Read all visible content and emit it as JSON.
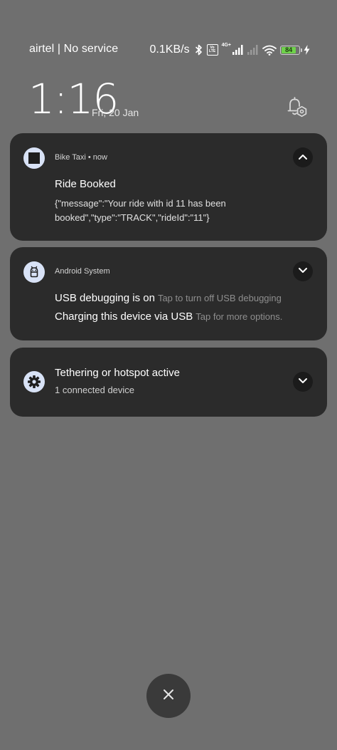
{
  "status_bar": {
    "carrier": "airtel | No service",
    "net_speed": "0.1KB/s",
    "volte_line1": "Vo",
    "volte_line2": "LTE",
    "net_type": "4G+",
    "battery_level": 84,
    "battery_level_text": "84",
    "battery_color": "#6fd24b",
    "icons": [
      "bluetooth-icon",
      "volte-icon",
      "signal-icon",
      "signal-no-service-icon",
      "wifi-icon",
      "battery-icon",
      "charging-icon"
    ]
  },
  "lockscreen": {
    "time": "1:16",
    "date": "Fri, 20 Jan",
    "settings_icon": "notification-settings-icon"
  },
  "notifications": [
    {
      "app": "Bike Taxi",
      "time": "now",
      "header": "Bike Taxi  •  now",
      "title": "Ride Booked",
      "body": "{\"message\":\"Your ride with id 11 has been booked\",\"type\":\"TRACK\",\"rideId\":\"11\"}",
      "icon": "app-square-icon",
      "expand_icon": "chevron-up-icon"
    },
    {
      "app": "Android System",
      "icon": "android-system-icon",
      "expand_icon": "chevron-down-icon",
      "items": [
        {
          "title": "USB debugging is on",
          "subtitle": "Tap to turn off USB debugging"
        },
        {
          "title": "Charging this device via USB",
          "subtitle": "Tap for more options."
        }
      ]
    },
    {
      "title": "Tethering or hotspot active",
      "subtitle": "1 connected device",
      "icon": "gear-icon",
      "expand_icon": "chevron-down-icon"
    }
  ],
  "dismiss_all": {
    "icon": "close-icon"
  },
  "colors": {
    "background": "#6f6f6f",
    "card": "#2b2b2b",
    "icon_accent": "#d8e2f6"
  }
}
